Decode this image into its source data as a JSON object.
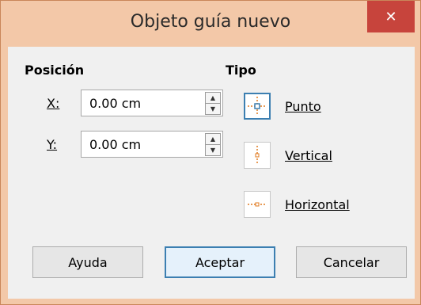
{
  "window": {
    "title": "Objeto guía nuevo",
    "close_symbol": "✕"
  },
  "position": {
    "heading": "Posición",
    "x": {
      "label": "X:",
      "value": "0.00 cm"
    },
    "y": {
      "label": "Y:",
      "value": "0.00 cm"
    }
  },
  "type": {
    "heading": "Tipo",
    "options": [
      {
        "label": "Punto",
        "icon": "point-guide-icon",
        "selected": true
      },
      {
        "label": "Vertical",
        "icon": "vertical-guide-icon",
        "selected": false
      },
      {
        "label": "Horizontal",
        "icon": "horizontal-guide-icon",
        "selected": false
      }
    ]
  },
  "buttons": {
    "help": "Ayuda",
    "ok": "Aceptar",
    "cancel": "Cancelar"
  },
  "colors": {
    "titlebar": "#f3c8a8",
    "close": "#c7443c",
    "accent": "#3c7fb1",
    "guide": "#e07a1e"
  }
}
